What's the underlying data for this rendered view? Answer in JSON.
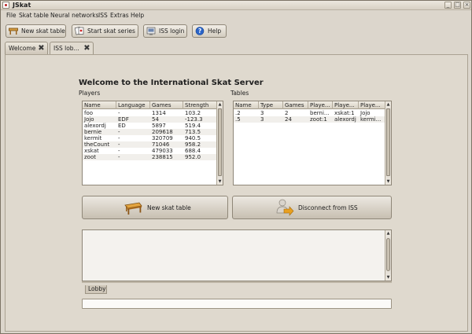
{
  "window": {
    "title": "JSkat"
  },
  "menu": [
    "File",
    "Skat table",
    "Neural networks",
    "ISS",
    "Extras",
    "Help"
  ],
  "toolbar": {
    "new_skat_table": "New skat table",
    "start_skat_series": "Start skat series",
    "iss_login": "ISS login",
    "help": "Help"
  },
  "tabs": [
    "Welcome",
    "ISS lob..."
  ],
  "lobby": {
    "heading": "Welcome to the International Skat Server",
    "players_label": "Players",
    "tables_label": "Tables",
    "players": {
      "columns": [
        "Name",
        "Language",
        "Games",
        "Strength"
      ],
      "rows": [
        [
          "foo",
          "-",
          "1314",
          "103.2"
        ],
        [
          "Jojo",
          "EDF",
          "54",
          "-123.3"
        ],
        [
          "alexordj",
          "ED",
          "5897",
          "519.4"
        ],
        [
          "bernie",
          "-",
          "209618",
          "713.5"
        ],
        [
          "kermit",
          "-",
          "320709",
          "940.5"
        ],
        [
          "theCount",
          "-",
          "71046",
          "958.2"
        ],
        [
          "xskat",
          "-",
          "479033",
          "688.4"
        ],
        [
          "zoot",
          "-",
          "238815",
          "952.0"
        ]
      ]
    },
    "tables": {
      "columns": [
        "Name",
        "Type",
        "Games",
        "Playe...",
        "Playe...",
        "Playe..."
      ],
      "rows": [
        [
          ".2",
          "3",
          "2",
          "berni...",
          "xskat:1",
          "Jojo"
        ],
        [
          ".5",
          "3",
          "24",
          "zoot:1",
          "alexordj",
          "kermi..."
        ]
      ]
    },
    "new_table_button": "New skat table",
    "disconnect_button": "Disconnect from ISS",
    "chat_tab": "Lobby",
    "chat_input": ""
  },
  "icons": [
    "app-icon",
    "table-icon",
    "cards-icon",
    "server-icon",
    "help-icon",
    "close-icon",
    "disconnect-icon"
  ],
  "colors": {
    "window_bg": "#dcd6cc",
    "help_icon": "#2a64c8",
    "table_wood": "#c98a2b",
    "arrow_orange": "#e8a020"
  }
}
